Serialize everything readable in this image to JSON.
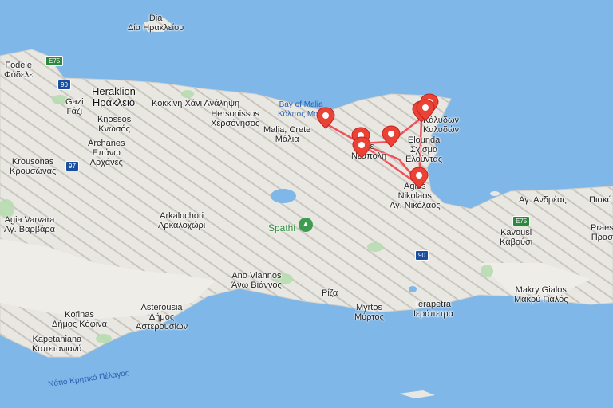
{
  "colors": {
    "sea": "#7fb7e8",
    "land": "#eeece6",
    "route": "#f0505a",
    "pin": "#ea4335",
    "park": "#3f9b4f"
  },
  "labels": {
    "dia": [
      "Dia",
      "Δία Ηρακλείου"
    ],
    "fodele": [
      "Fodele",
      "Φόδελε"
    ],
    "heraklion": [
      "Heraklion",
      "Ηράκλειο"
    ],
    "gazi": [
      "Gazi",
      "Γάζι"
    ],
    "kokkini": [
      "Κοκκίνη Χάνι Ανάληψη"
    ],
    "knossos": [
      "Knossos",
      "Κνωσός"
    ],
    "hersonissos": [
      "Hersonissos",
      "Χερσόνησος"
    ],
    "bay_malia": [
      "Bay of Malia",
      "Κόλπος Μαλί"
    ],
    "malia": [
      "Malia, Crete",
      "Μάλια"
    ],
    "krousonas": [
      "Krousonas",
      "Κρουσώνας"
    ],
    "archanes": [
      "Archanes",
      "Επάνω",
      "Αρχάνες"
    ],
    "neapoli": [
      "Νε",
      "Νεάπολη"
    ],
    "elounda": [
      "Elounda",
      "Σχίσμα",
      "Ελούντας"
    ],
    "kalydon": [
      "Κάλυδων",
      "Καλυδών"
    ],
    "agios_nikolaos": [
      "Agios",
      "Nikolaos",
      "Αγ. Νικόλαος"
    ],
    "agia_varvara": [
      "Agia Varvara",
      "Αγ. Βαρβάρα"
    ],
    "arkalochori": [
      "Arkalochori",
      "Αρκαλοχώρι"
    ],
    "spathi": [
      "Spathi"
    ],
    "ag_andreas": [
      "Αγ. Ανδρέας"
    ],
    "pisko": [
      "Πισκό"
    ],
    "kavousi": [
      "Kavousi",
      "Καβούσι"
    ],
    "praesos": [
      "Praesi",
      "Πρασι"
    ],
    "ano_viannos": [
      "Ano Viannos",
      "Άνω Βιάννος"
    ],
    "riza": [
      "Ρίζα"
    ],
    "myrtos": [
      "Myrtos",
      "Μύρτος"
    ],
    "ierapetra": [
      "Ierapetra",
      "Ιεράπετρα"
    ],
    "makry_gialos": [
      "Makry Gialos",
      "Μακρύ Γιαλός"
    ],
    "kofinas": [
      "Kofinas",
      "Δήμος Κόφινα"
    ],
    "asterousia": [
      "Asterousia",
      "Δήμος",
      "Αστερουσίων"
    ],
    "kapetaniana": [
      "Kapetaniana",
      "Καπετανιανά"
    ],
    "libyan_sea": [
      "Νότιο Κρητικό Πέλαγος"
    ]
  },
  "road_shields": {
    "e75_west": "E75",
    "r90_west": "90",
    "r97": "97",
    "r90_east": "90",
    "e75_east": "E75"
  },
  "markers": [
    "marker-1",
    "marker-2",
    "marker-3",
    "marker-4",
    "marker-5",
    "marker-6",
    "marker-7",
    "marker-8"
  ]
}
